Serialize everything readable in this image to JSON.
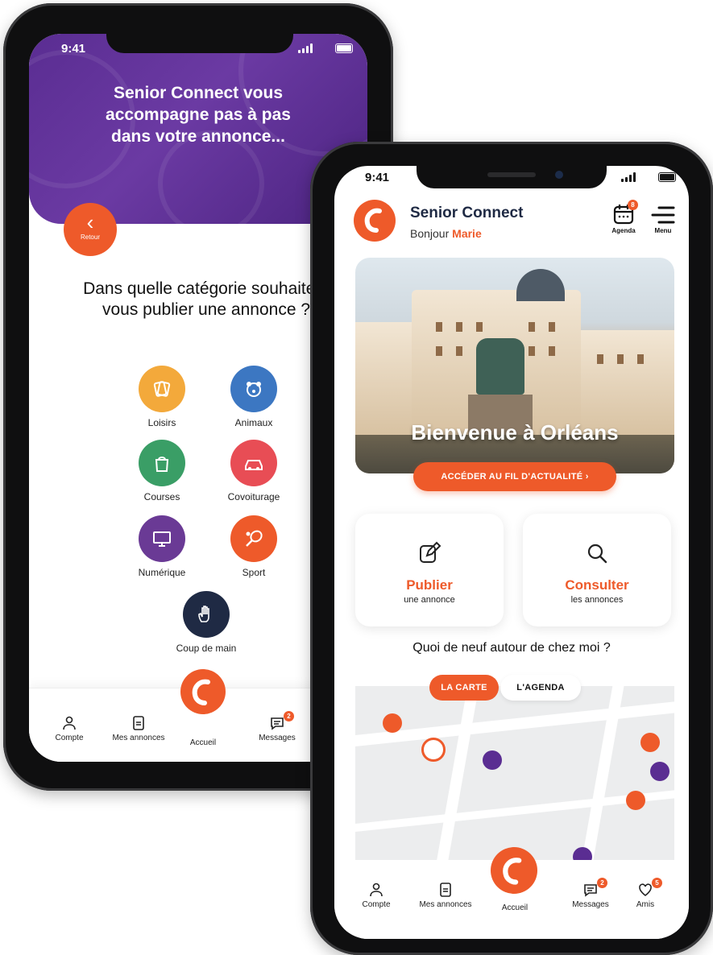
{
  "colors": {
    "accent": "#ee5a2a",
    "purple": "#5a2d92",
    "navy": "#1f2a44"
  },
  "back_screen": {
    "status_time": "9:41",
    "hero_text": "Senior Connect vous accompagne pas à pas dans votre annonce...",
    "back_button": {
      "label": "Retour"
    },
    "question": "Dans quelle catégorie souhaitez-vous publier une annonce ?",
    "categories": [
      {
        "label": "Loisirs",
        "icon": "cards-icon",
        "color": "#f3a93b"
      },
      {
        "label": "Animaux",
        "icon": "pet-icon",
        "color": "#3c77c2"
      },
      {
        "label": "Courses",
        "icon": "grocery-bag-icon",
        "color": "#3a9e66"
      },
      {
        "label": "Covoiturage",
        "icon": "car-icon",
        "color": "#e84d55"
      },
      {
        "label": "Numérique",
        "icon": "computer-icon",
        "color": "#6a3a95"
      },
      {
        "label": "Sport",
        "icon": "tennis-icon",
        "color": "#ee5a2a"
      },
      {
        "label": "Coup de main",
        "icon": "hand-icon",
        "color": "#1f2a44"
      }
    ],
    "tabs": [
      {
        "label": "Compte",
        "icon": "person-icon"
      },
      {
        "label": "Mes annonces",
        "icon": "document-icon"
      },
      {
        "label": "Accueil",
        "icon": "home-logo-icon"
      },
      {
        "label": "Messages",
        "icon": "message-icon",
        "badge": "2"
      }
    ]
  },
  "front_screen": {
    "status_time": "9:41",
    "app_title": "Senior Connect",
    "greeting_prefix": "Bonjour",
    "greeting_name": "Marie",
    "agenda": {
      "label": "Agenda",
      "badge": "8"
    },
    "menu": {
      "label": "Menu"
    },
    "hero": {
      "title": "Bienvenue à Orléans",
      "cta": "ACCÉDER AU FIL D'ACTUALITÉ ›"
    },
    "cards": [
      {
        "title": "Publier",
        "subtitle": "une annonce",
        "icon": "edit-icon"
      },
      {
        "title": "Consulter",
        "subtitle": "les annonces",
        "icon": "search-icon"
      }
    ],
    "section_title": "Quoi de neuf autour de chez moi ?",
    "toggle": {
      "active": "LA CARTE",
      "inactive": "L'AGENDA"
    },
    "tabs": [
      {
        "label": "Compte",
        "icon": "person-icon"
      },
      {
        "label": "Mes annonces",
        "icon": "document-icon"
      },
      {
        "label": "Accueil",
        "icon": "home-logo-icon"
      },
      {
        "label": "Messages",
        "icon": "message-icon",
        "badge": "2"
      },
      {
        "label": "Amis",
        "icon": "heart-icon",
        "badge": "5"
      }
    ]
  }
}
